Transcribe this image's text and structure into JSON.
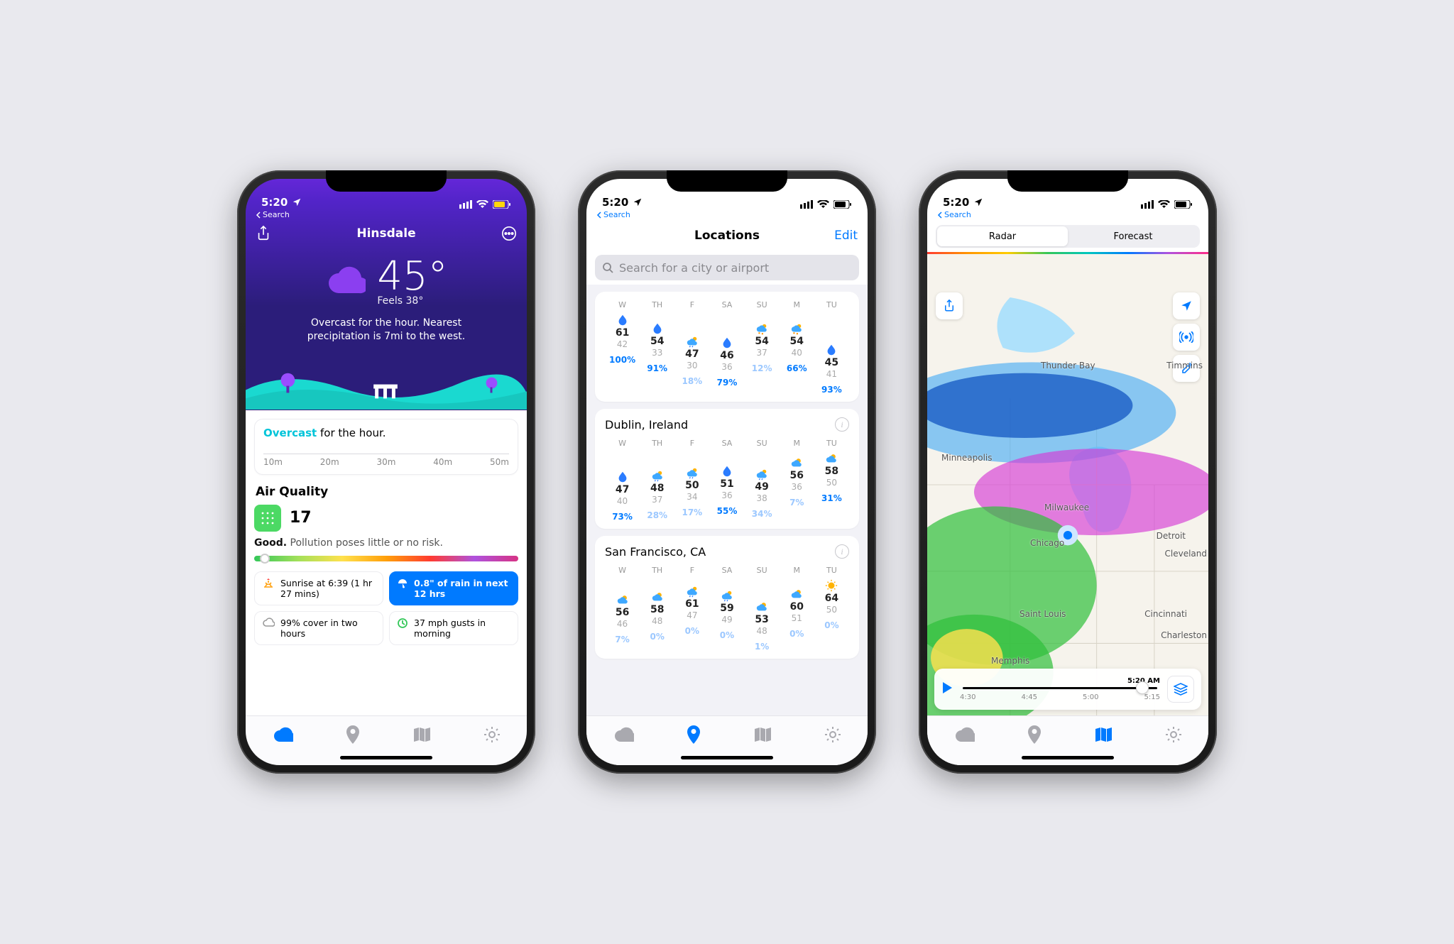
{
  "status": {
    "time": "5:20",
    "breadcrumb": "Search"
  },
  "tabs": {
    "forecast": "forecast",
    "locations": "locations",
    "map": "map",
    "settings": "settings"
  },
  "phone1": {
    "title": "Hinsdale",
    "temp": "45°",
    "feels": "Feels 38°",
    "summary": "Overcast for the hour. Nearest precipitation is 7mi to the west.",
    "next_highlight": "Overcast",
    "next_suffix": " for the hour.",
    "ruler": [
      "10m",
      "20m",
      "30m",
      "40m",
      "50m"
    ],
    "aq": {
      "title": "Air Quality",
      "value": "17",
      "level": "Good.",
      "desc": "Pollution poses little or no risk."
    },
    "tiles": {
      "sunrise": "Sunrise at 6:39 (1 hr 27 mins)",
      "rain": "0.8\" of rain in next 12 hrs",
      "cloud": "99% cover in two hours",
      "wind": "37 mph gusts in morning"
    }
  },
  "phone2": {
    "title": "Locations",
    "edit": "Edit",
    "search_placeholder": "Search for a city or airport",
    "card1": {
      "days": [
        {
          "d": "W",
          "icon": "drop",
          "hi": "61",
          "lo": "42",
          "p": "100%",
          "pc": "hi"
        },
        {
          "d": "TH",
          "icon": "drop",
          "hi": "54",
          "lo": "33",
          "p": "91%",
          "pc": "hi"
        },
        {
          "d": "F",
          "icon": "psun",
          "hi": "47",
          "lo": "30",
          "p": "18%",
          "pc": "lo"
        },
        {
          "d": "SA",
          "icon": "drop",
          "hi": "46",
          "lo": "36",
          "p": "79%",
          "pc": "hi"
        },
        {
          "d": "SU",
          "icon": "psunr",
          "hi": "54",
          "lo": "37",
          "p": "12%",
          "pc": "lo"
        },
        {
          "d": "M",
          "icon": "psunr",
          "hi": "54",
          "lo": "40",
          "p": "66%",
          "pc": "hi"
        },
        {
          "d": "TU",
          "icon": "drop",
          "hi": "45",
          "lo": "41",
          "p": "93%",
          "pc": "hi"
        }
      ]
    },
    "card2": {
      "name": "Dublin, Ireland",
      "days": [
        {
          "d": "W",
          "icon": "drop",
          "hi": "47",
          "lo": "40",
          "p": "73%",
          "pc": "hi"
        },
        {
          "d": "TH",
          "icon": "psun",
          "hi": "48",
          "lo": "37",
          "p": "28%",
          "pc": "lo"
        },
        {
          "d": "F",
          "icon": "psun",
          "hi": "50",
          "lo": "34",
          "p": "17%",
          "pc": "lo"
        },
        {
          "d": "SA",
          "icon": "drop",
          "hi": "51",
          "lo": "36",
          "p": "55%",
          "pc": "hi"
        },
        {
          "d": "SU",
          "icon": "psun",
          "hi": "49",
          "lo": "38",
          "p": "34%",
          "pc": "lo"
        },
        {
          "d": "M",
          "icon": "pcloud",
          "hi": "56",
          "lo": "36",
          "p": "7%",
          "pc": "lo"
        },
        {
          "d": "TU",
          "icon": "pcloud",
          "hi": "58",
          "lo": "50",
          "p": "31%",
          "pc": "hi"
        }
      ]
    },
    "card3": {
      "name": "San Francisco, CA",
      "days": [
        {
          "d": "W",
          "icon": "pcloud",
          "hi": "56",
          "lo": "46",
          "p": "7%",
          "pc": "lo"
        },
        {
          "d": "TH",
          "icon": "pcloud",
          "hi": "58",
          "lo": "48",
          "p": "0%",
          "pc": "lo"
        },
        {
          "d": "F",
          "icon": "psun",
          "hi": "61",
          "lo": "47",
          "p": "0%",
          "pc": "lo"
        },
        {
          "d": "SA",
          "icon": "psun",
          "hi": "59",
          "lo": "49",
          "p": "0%",
          "pc": "lo"
        },
        {
          "d": "SU",
          "icon": "pcloud",
          "hi": "53",
          "lo": "48",
          "p": "1%",
          "pc": "lo"
        },
        {
          "d": "M",
          "icon": "pcloud",
          "hi": "60",
          "lo": "51",
          "p": "0%",
          "pc": "lo"
        },
        {
          "d": "TU",
          "icon": "sun",
          "hi": "64",
          "lo": "50",
          "p": "0%",
          "pc": "lo"
        }
      ]
    }
  },
  "phone3": {
    "seg": {
      "radar": "Radar",
      "forecast": "Forecast"
    },
    "cities": [
      "Thunder Bay",
      "Timmins",
      "Minneapolis",
      "Milwaukee",
      "Chicago",
      "Detroit",
      "Cleveland",
      "Cincinnati",
      "Saint Louis",
      "Charleston",
      "Memphis"
    ],
    "time_now": "5:20 AM",
    "ticks": [
      "4:30",
      "4:45",
      "5:00",
      "5:15"
    ]
  }
}
